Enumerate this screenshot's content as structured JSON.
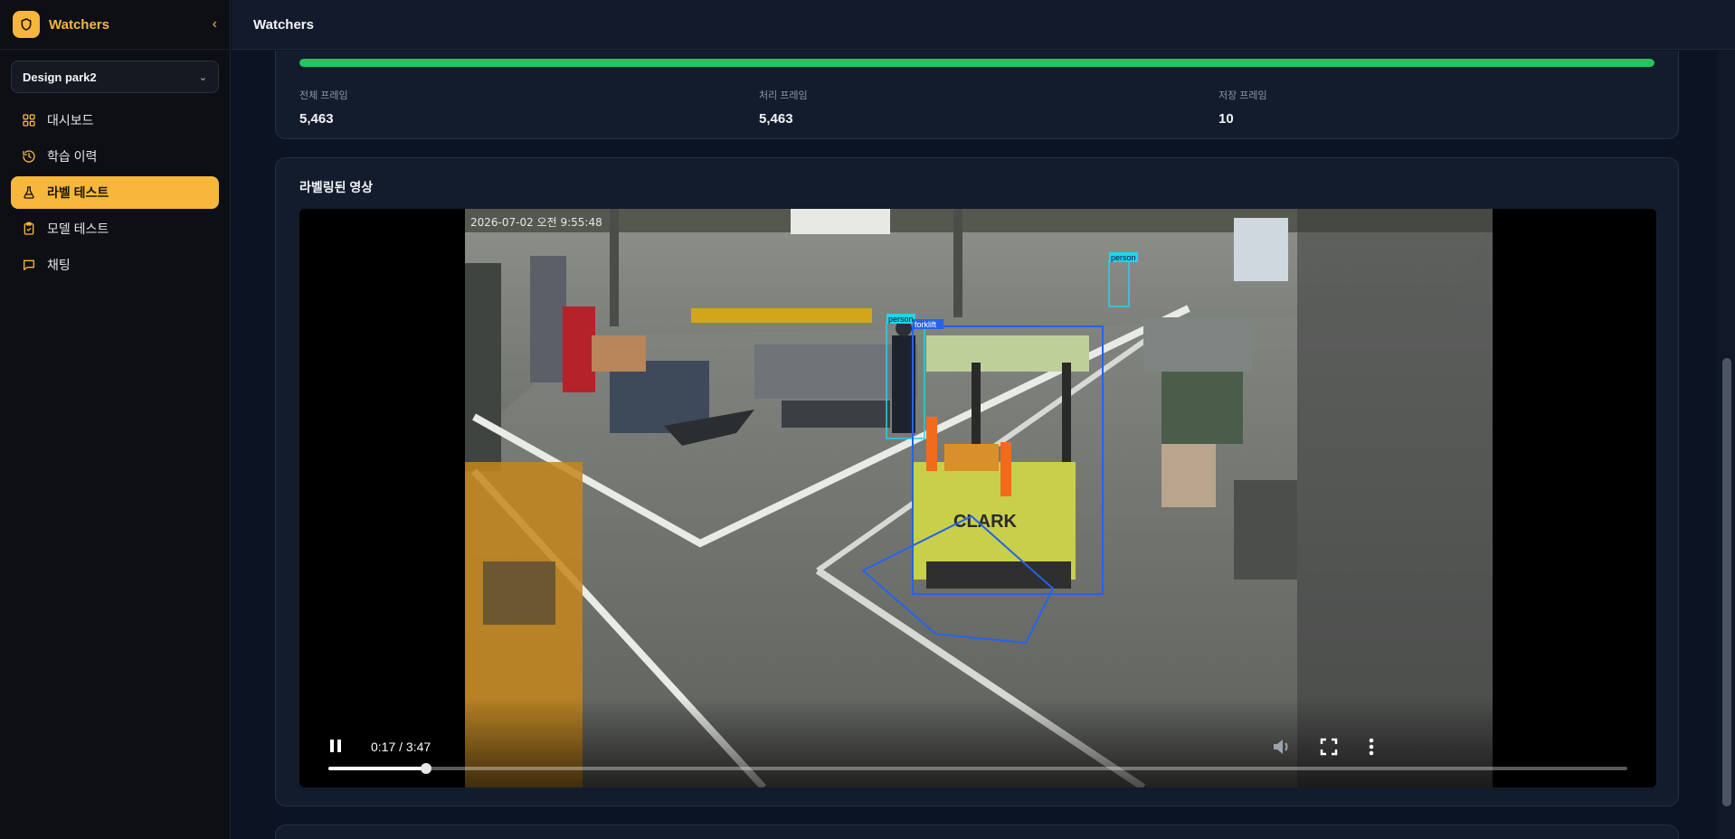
{
  "app": {
    "title": "Watchers"
  },
  "sidebar": {
    "workspace": "Design park2",
    "items": [
      {
        "label": "대시보드",
        "icon": "grid-icon",
        "active": false
      },
      {
        "label": "학습 이력",
        "icon": "history-icon",
        "active": false
      },
      {
        "label": "라벨 테스트",
        "icon": "flask-icon",
        "active": true
      },
      {
        "label": "모델 테스트",
        "icon": "clipboard-check-icon",
        "active": false
      },
      {
        "label": "채팅",
        "icon": "chat-icon",
        "active": false
      }
    ]
  },
  "header": {
    "title": "Watchers"
  },
  "stats": {
    "progress": 1.0,
    "total_frames": {
      "label": "전체 프레임",
      "value": "5,463"
    },
    "processed_frames": {
      "label": "처리 프레임",
      "value": "5,463"
    },
    "saved_frames": {
      "label": "저장 프레임",
      "value": "10"
    }
  },
  "video": {
    "section_title": "라벨링된 영상",
    "overlay_timestamp": "2026-07-02 오전 9:55:48",
    "time": "0:17 / 3:47",
    "played_fraction": 0.075,
    "detection_labels": [
      "person",
      "forklift",
      "person"
    ]
  },
  "colors": {
    "accent": "#f6b73c",
    "progress": "#22c55e",
    "detection_box": "#2563eb",
    "person_box": "#22d3ee"
  }
}
